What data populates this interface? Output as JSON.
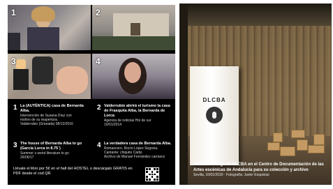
{
  "collage": {
    "tiles": [
      {
        "number": "1"
      },
      {
        "number": "2"
      },
      {
        "number": "3"
      },
      {
        "number": "4"
      }
    ],
    "items": [
      {
        "number": "1",
        "title": "La (AUTÉNTICA) casa de Bernarda Alba.",
        "subtitle": "Intervención de Susana Díaz con\nmotivo de su reapertura.\nValderrubio (Granada) 08/12/2016"
      },
      {
        "number": "2",
        "title": "Valderrubio abrirá el turismo la casa de Frasquita Alba, la Bernarda de Lorca",
        "subtitle": "Agencia de noticias Hoi de sur\n10/01/2014"
      },
      {
        "number": "3",
        "title": "The house of Bernarda Alba to go (García Lorca in 8.75´)",
        "subtitle": "Summer´s weird literature to go\n26/06/17"
      },
      {
        "number": "4",
        "title": "La verdadera casa de Bernarda Alba.",
        "subtitle": "Romancero. Rocío López Segovia.\nCantante: chiquito Cádiz.\nArchivo de Manuel Fernández carrasco"
      }
    ],
    "promo": "Llévate el libro por 5€ en el hall del HOSTEL o descárgalo GRATIS en PDF desde el cod QR"
  },
  "photo": {
    "book_title": "DLCBA",
    "caption_title": "Acto de entrega de DLCBA en el Centro de Documentación de las Artes escénicas de Andalucía para su colección y archivo",
    "caption_sub": "Sevilla, 10/01/2019 · Fotografía: Javier Esquivias"
  }
}
